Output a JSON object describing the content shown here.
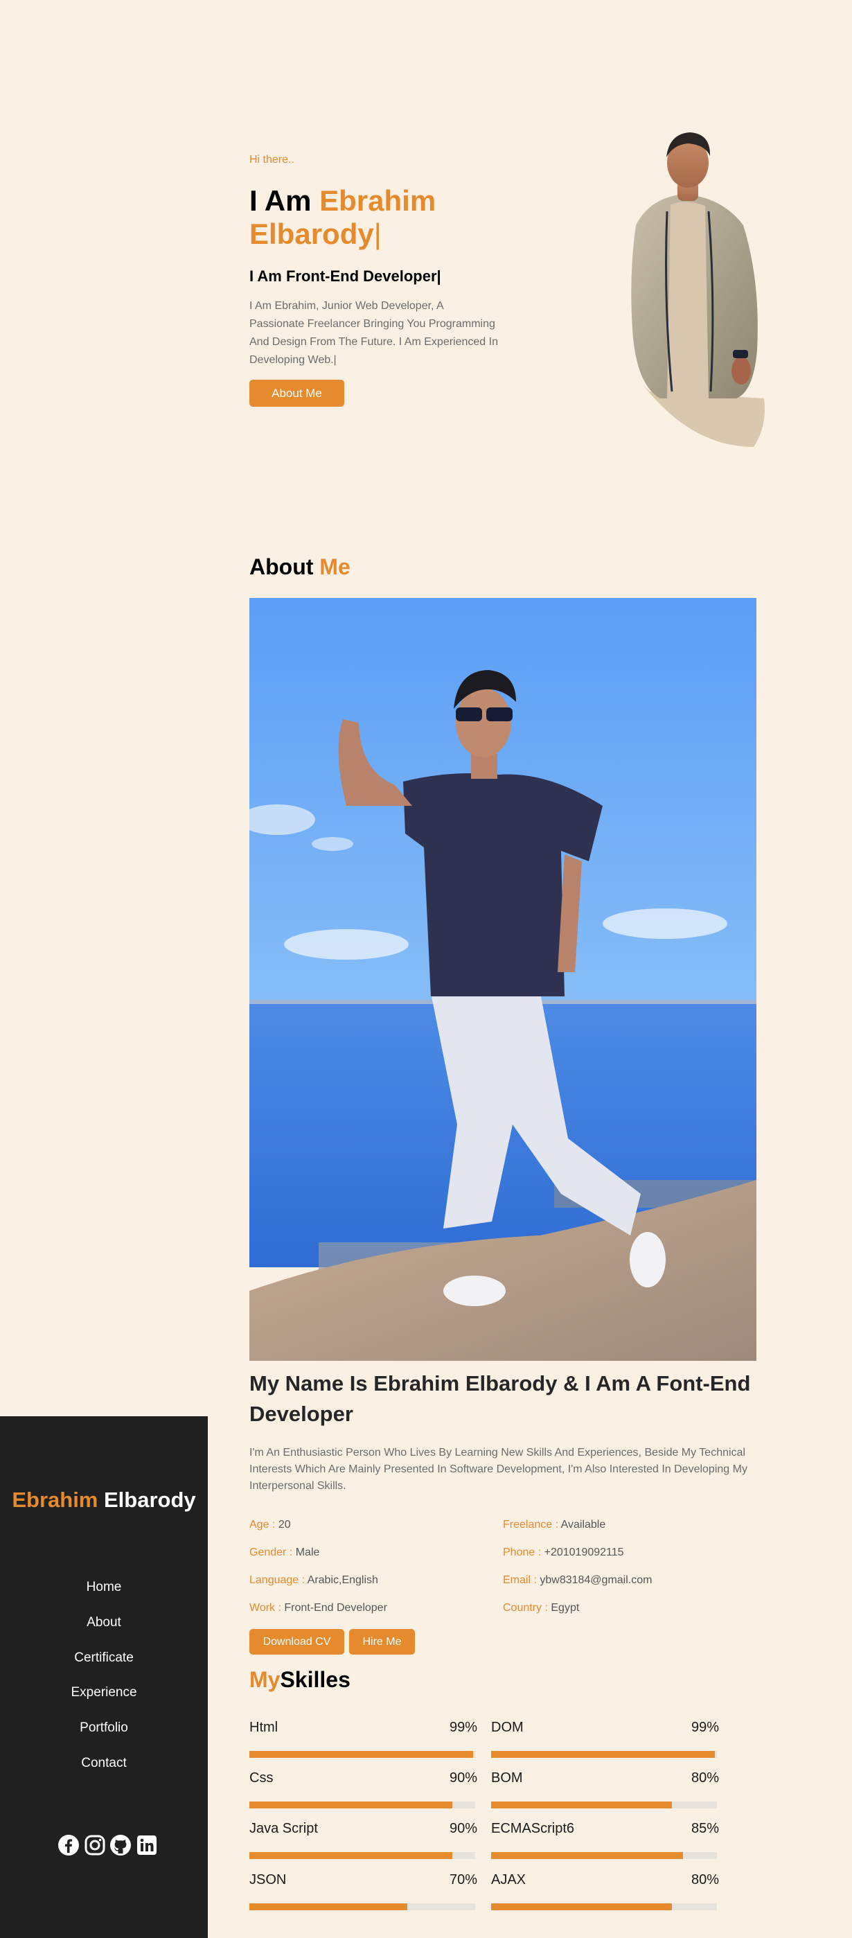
{
  "hero": {
    "greeting": "Hi there..",
    "title_prefix": "I Am ",
    "title_name": "Ebrahim Elbarody",
    "title_cursor": "|",
    "subtitle": "I Am Front-End Developer|",
    "description": "I Am Ebrahim, Junior Web Developer, A Passionate Freelancer Bringing You Programming And Design From The Future. I Am Experienced In Developing Web.|",
    "button_label": "About Me"
  },
  "about": {
    "heading_black": "About ",
    "heading_accent": "Me",
    "name_line": "My Name Is Ebrahim Elbarody & I Am A Font-End Developer",
    "bio": "I'm An Enthusiastic Person Who Lives By Learning New Skills And Experiences, Beside My Technical Interests Which Are Mainly Presented In Software Development, I'm Also Interested In Developing My Interpersonal Skills.",
    "info": {
      "age_key": "Age :",
      "age_val": "20",
      "gender_key": "Gender :",
      "gender_val": "Male",
      "language_key": "Language :",
      "language_val": "Arabic,English",
      "work_key": "Work :",
      "work_val": "Front-End Developer",
      "freelance_key": "Freelance :",
      "freelance_val": "Available",
      "phone_key": "Phone :",
      "phone_val": "+201019092115",
      "email_key": "Email :",
      "email_val": "ybw83184@gmail.com",
      "country_key": "Country :",
      "country_val": "Egypt"
    },
    "download_cv_label": "Download CV",
    "hire_me_label": "Hire Me"
  },
  "skills": {
    "heading_accent": "My",
    "heading_black": "Skilles",
    "items": [
      {
        "name": "Html",
        "percent": "99%",
        "level": 0.99
      },
      {
        "name": "DOM",
        "percent": "99%",
        "level": 0.99
      },
      {
        "name": "Css",
        "percent": "90%",
        "level": 0.9
      },
      {
        "name": "BOM",
        "percent": "80%",
        "level": 0.8
      },
      {
        "name": "Java Script",
        "percent": "90%",
        "level": 0.9
      },
      {
        "name": "ECMAScript6",
        "percent": "85%",
        "level": 0.85
      },
      {
        "name": "JSON",
        "percent": "70%",
        "level": 0.7
      },
      {
        "name": "AJAX",
        "percent": "80%",
        "level": 0.8
      }
    ]
  },
  "sidebar": {
    "brand_first": "Ebrahim",
    "brand_last": " Elbarody",
    "nav": [
      "Home",
      "About",
      "Certificate",
      "Experience",
      "Portfolio",
      "Contact"
    ],
    "social_icons": [
      "facebook-icon",
      "instagram-icon",
      "github-icon",
      "linkedin-icon"
    ]
  },
  "colors": {
    "background": "#fbf0e4",
    "accent": "#e58a2d",
    "sidebar": "#202020"
  }
}
